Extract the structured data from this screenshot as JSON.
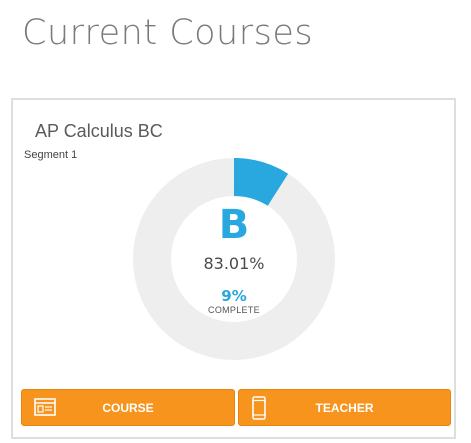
{
  "page": {
    "title": "Current Courses"
  },
  "course": {
    "name": "AP Calculus BC",
    "segment": "Segment 1",
    "grade_letter": "B",
    "grade_percent": "83.01%",
    "completion_fraction": 0.09,
    "complete_percent": "9%",
    "complete_label": "COMPLETE",
    "buttons": {
      "course_label": "COURSE",
      "course_icon": "course-content-icon",
      "teacher_label": "TEACHER",
      "teacher_icon": "mobile-phone-icon"
    }
  },
  "colors": {
    "accent_blue": "#29a8e0",
    "ring_track": "#eeeeee",
    "button_orange": "#f7941d"
  }
}
